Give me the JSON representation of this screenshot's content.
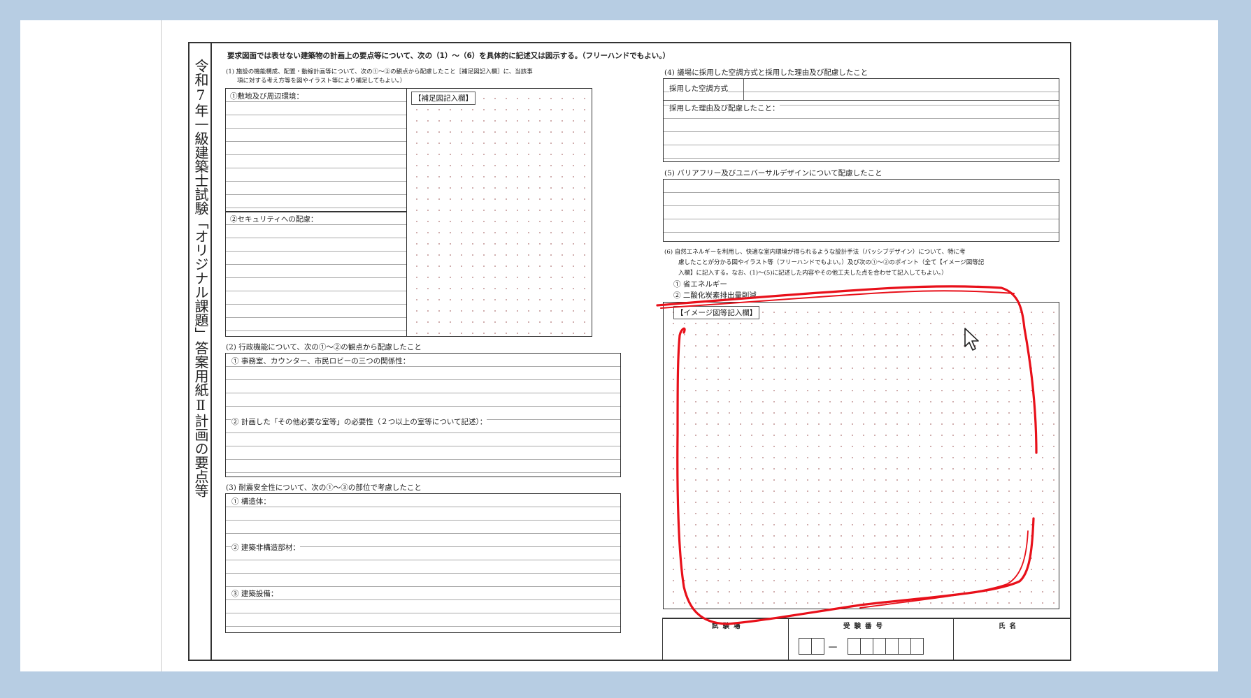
{
  "sheet": {
    "title_vertical": "令和7年一級建築士試験「オリジナル課題」答案用紙Ⅱ計画の要点等",
    "instruction": "要求図面では表せない建築物の計画上の要点等について、次の（1）～（6）を具体的に記述又は図示する。（フリーハンドでもよい。）",
    "q1": {
      "heading": "(1) 施設の機能構成、配置・動線計画等について、次の①～②の観点から配慮したこと［補足図記入欄］に、当該事",
      "heading2": "項に対する考え方等を図やイラスト等により補足してもよい。）",
      "item1": "①敷地及び周辺環境：",
      "item2": "②セキュリティへの配慮：",
      "supplement_tag": "【補足図記入欄】"
    },
    "q2": {
      "heading": "(2) 行政機能について、次の①～②の観点から配慮したこと",
      "item1": "① 事務室、カウンター、市民ロビーの三つの関係性：",
      "item2": "② 計画した「その他必要な室等」の必要性（２つ以上の室等について記述）："
    },
    "q3": {
      "heading": "(3) 耐震安全性について、次の①～③の部位で考慮したこと",
      "item1": "① 構造体：",
      "item2": "② 建築非構造部材：",
      "item3": "③ 建築設備："
    },
    "q4": {
      "heading": "(4) 議場に採用した空調方式と採用した理由及び配慮したこと",
      "label1": "採用した空調方式",
      "label2": "採用した理由及び配慮したこと："
    },
    "q5": {
      "heading": "(5) バリアフリー及びユニバーサルデザインについて配慮したこと"
    },
    "q6": {
      "line1": "(6) 自然エネルギーを利用し、快適な室内環境が得られるような設計手法（パッシブデザイン）について、特に考",
      "line2": "慮したことが分かる図やイラスト等（フリーハンドでもよい。）及び次の①～②のポイント（全て【イメージ図等記",
      "line3": "入欄】に記入する。なお、(1)～(5)に記述した内容やその他工夫した点を合わせて記入してもよい。）",
      "item1": "① 省エネルギー",
      "item2": "② 二酸化炭素排出量削減",
      "image_tag": "【イメージ図等記入欄】"
    },
    "footer": {
      "venue": "試験場",
      "exam_number": "受験番号",
      "name": "氏名",
      "dash": "－"
    }
  },
  "annotation": {
    "color": "#e8101a"
  }
}
